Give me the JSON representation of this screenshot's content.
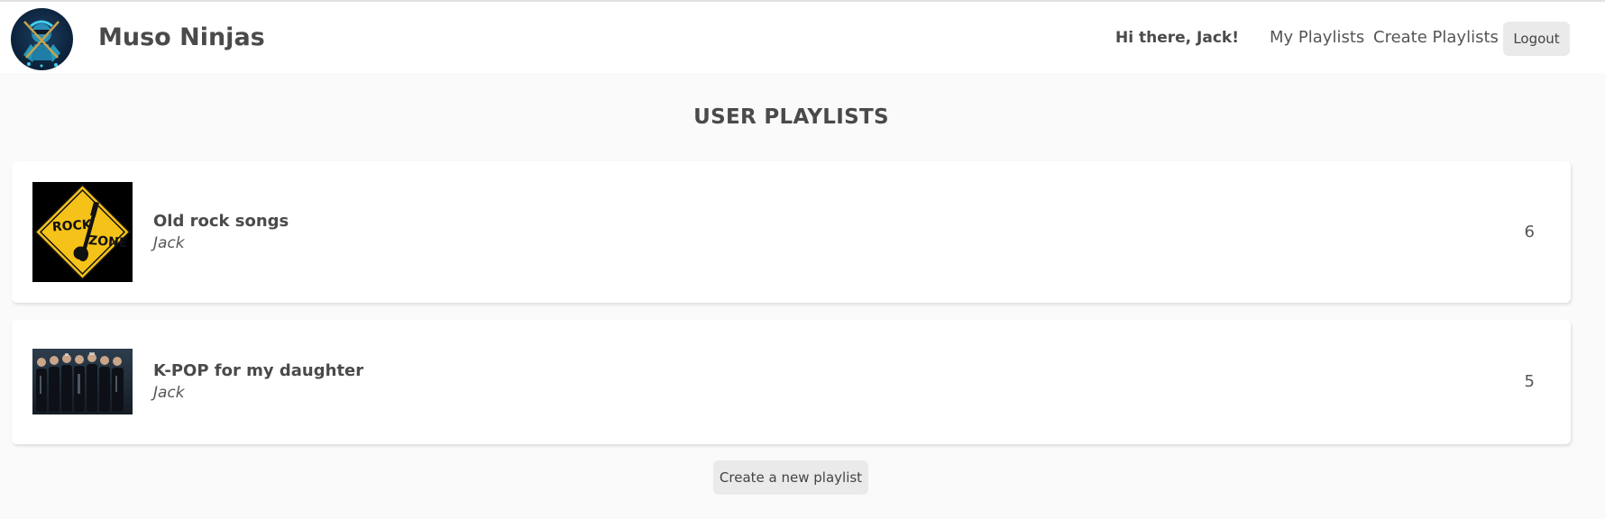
{
  "header": {
    "brand": "Muso Ninjas",
    "logo_icon": "ninja-logo-icon",
    "greeting": "Hi there, Jack!",
    "nav": [
      {
        "label": "My Playlists"
      },
      {
        "label": "Create Playlists"
      }
    ],
    "logout_label": "Logout"
  },
  "main": {
    "heading": "USER PLAYLISTS",
    "playlists": [
      {
        "title": "Old rock songs",
        "owner": "Jack",
        "count": "6",
        "cover_text": [
          "ROCK",
          "ZONE"
        ]
      },
      {
        "title": "K-POP for my daughter",
        "owner": "Jack",
        "count": "5"
      }
    ],
    "create_label": "Create a new playlist"
  },
  "colors": {
    "background": "#fafafa",
    "card": "#ffffff",
    "text": "#4a4a4a",
    "button": "#eaeaea",
    "rock_sign": "#f5c21a"
  }
}
